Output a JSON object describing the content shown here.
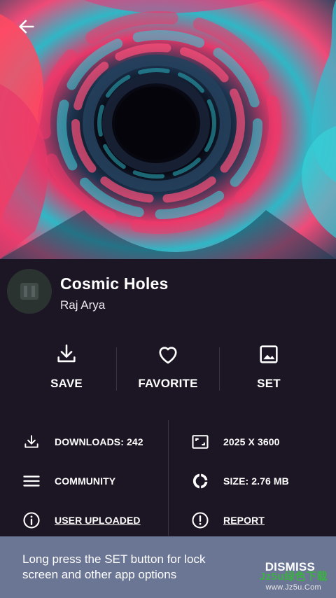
{
  "wallpaper": {
    "title": "Cosmic Holes",
    "author": "Raj Arya",
    "colors": {
      "pink": "#f0386a",
      "teal": "#34c6d0",
      "navy": "#1a2a44",
      "core": "#06050c"
    }
  },
  "header": {
    "back_icon": "arrow-left-icon"
  },
  "actions": [
    {
      "icon": "download-icon",
      "label": "SAVE"
    },
    {
      "icon": "heart-icon",
      "label": "FAVORITE"
    },
    {
      "icon": "image-icon",
      "label": "SET"
    }
  ],
  "details": {
    "downloads": {
      "icon": "download-icon",
      "text": "DOWNLOADS: 242"
    },
    "resolution": {
      "icon": "resolution-icon",
      "text": "2025 X 3600"
    },
    "category": {
      "icon": "menu-icon",
      "text": "COMMUNITY"
    },
    "size": {
      "icon": "pie-icon",
      "text": "SIZE: 2.76 MB"
    },
    "source": {
      "icon": "info-icon",
      "text": "USER UPLOADED"
    },
    "report": {
      "icon": "alert-icon",
      "text": "REPORT"
    }
  },
  "snackbar": {
    "message": "Long press the SET button for lock screen and other app options",
    "action": "DISMISS"
  },
  "watermark": {
    "line1": "Jz5u绿色下载",
    "line2": "www.Jz5u.Com"
  },
  "theme": {
    "background": "#1c1624",
    "snackbar": "#6b7594",
    "divider": "#3a3344"
  }
}
